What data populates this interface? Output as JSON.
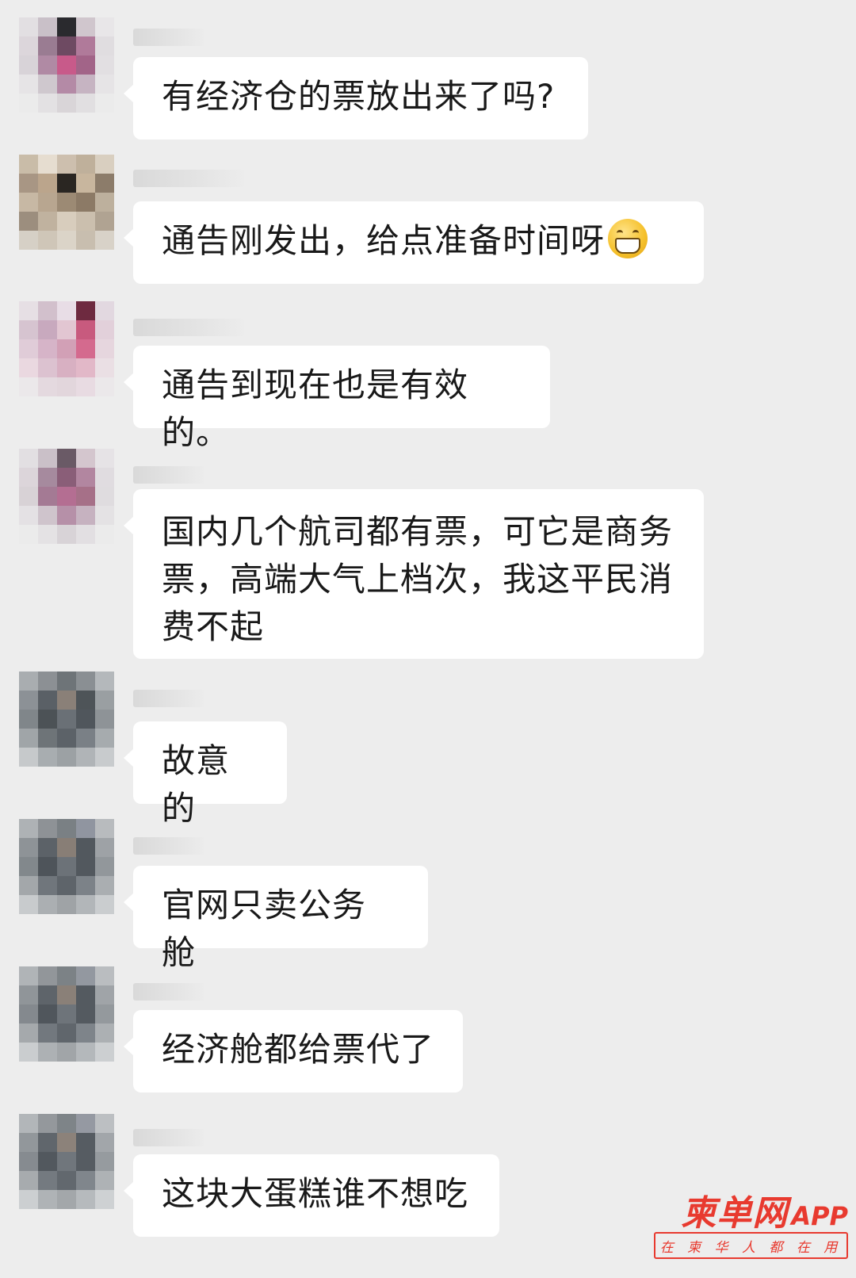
{
  "messages": [
    {
      "text": "有经济仓的票放出来了吗?",
      "emoji": null
    },
    {
      "text": "通告刚发出，给点准备时间呀",
      "emoji": "grinning-face-emoji"
    },
    {
      "text": "通告到现在也是有效的。",
      "emoji": null
    },
    {
      "text": "国内几个航司都有票，可它是商务票，高端大气上档次，我这平民消费不起",
      "emoji": null
    },
    {
      "text": "故意的",
      "emoji": null
    },
    {
      "text": "官网只卖公务舱",
      "emoji": null
    },
    {
      "text": "经济舱都给票代了",
      "emoji": null
    },
    {
      "text": "这块大蛋糕谁不想吃",
      "emoji": null
    }
  ],
  "watermark": {
    "brand": "柬单网",
    "app": "APP",
    "slogan": "在柬华人都在用",
    "color": "#e83a2f"
  },
  "colors": {
    "background": "#ededed",
    "bubble": "#ffffff",
    "text": "#191919"
  }
}
